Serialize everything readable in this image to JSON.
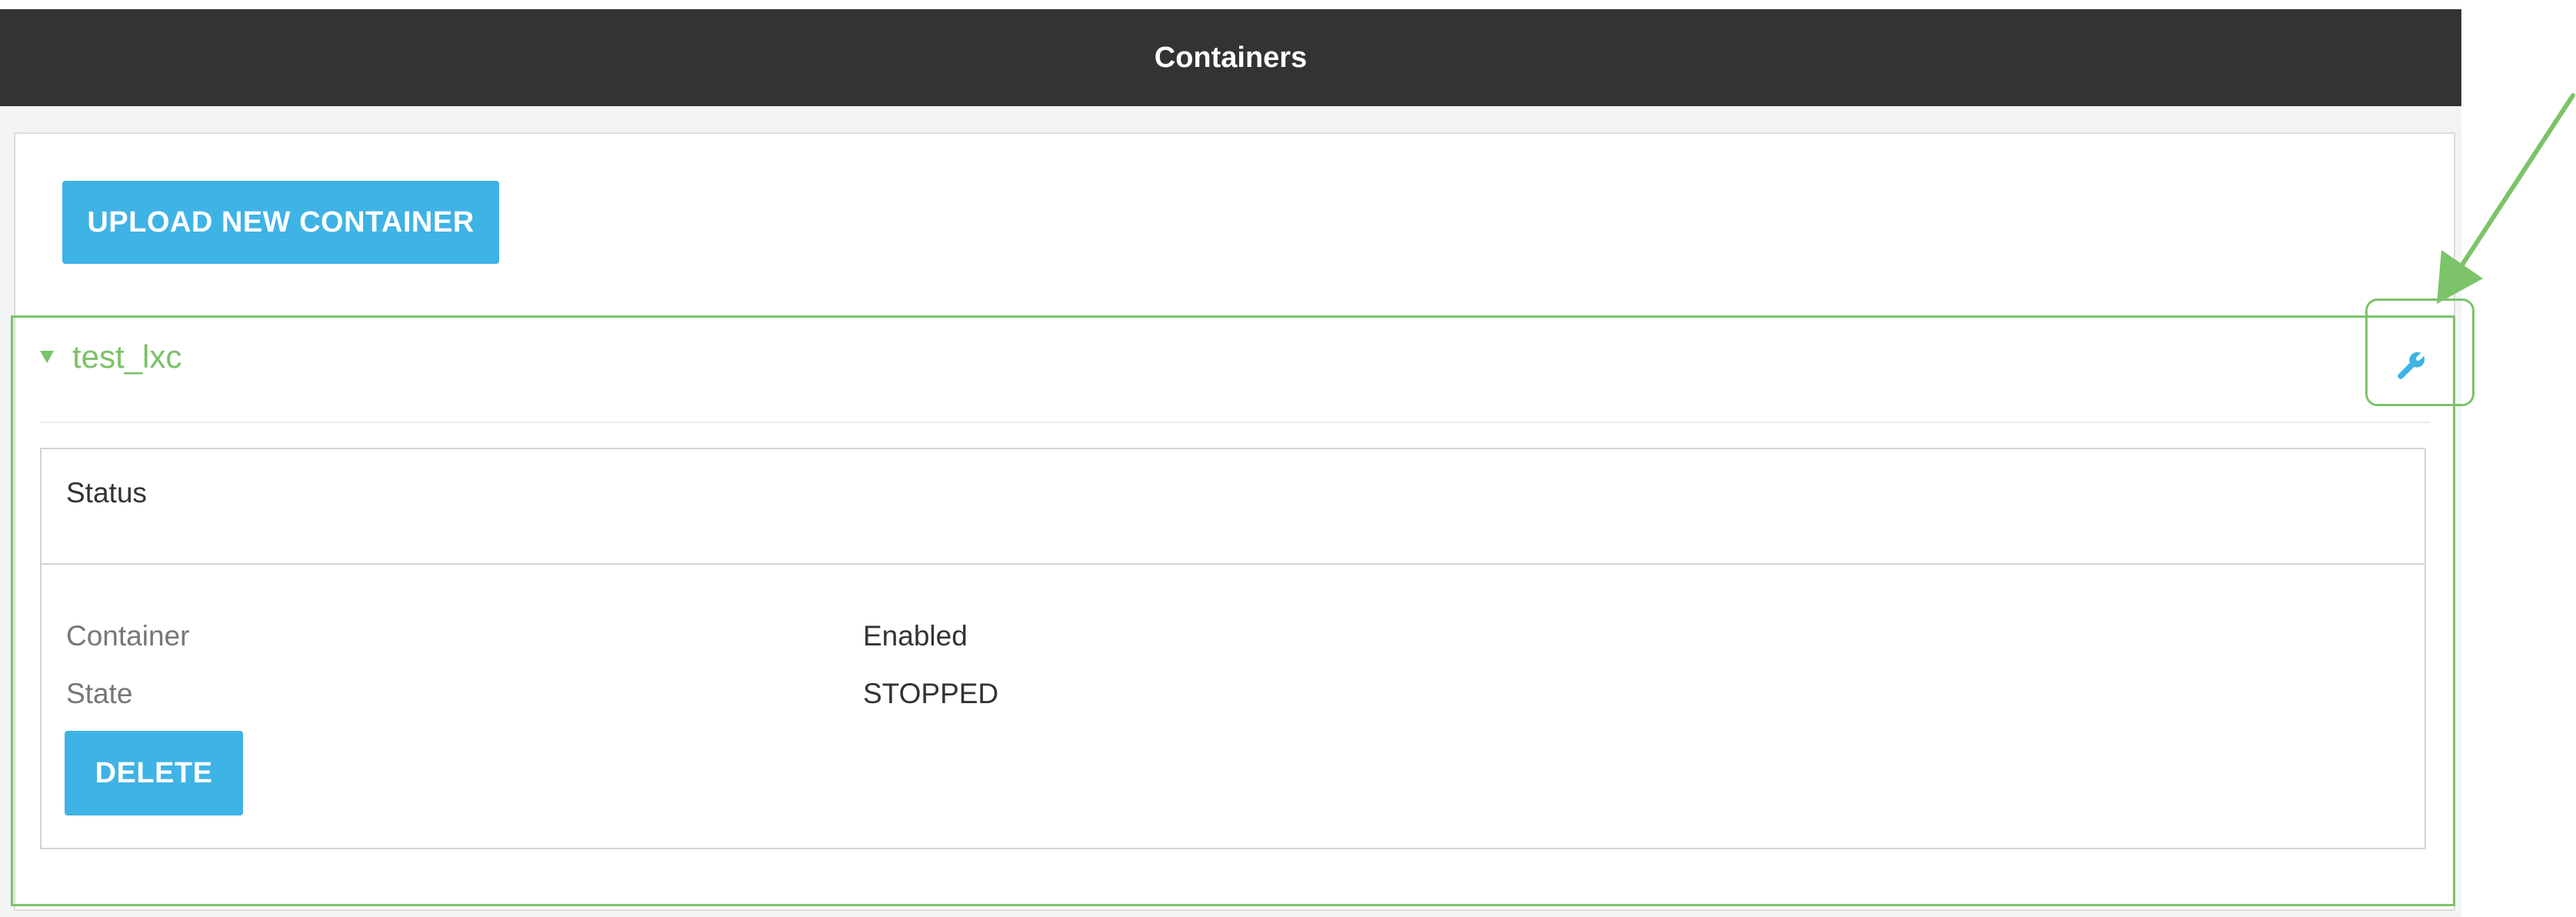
{
  "header": {
    "title": "Containers"
  },
  "actions": {
    "upload_label": "UPLOAD NEW CONTAINER"
  },
  "container": {
    "name": "test_lxc",
    "expanded_icon": "caret-down-icon",
    "config_icon": "wrench-icon",
    "status_section": {
      "title": "Status",
      "rows": [
        {
          "label": "Container",
          "value": "Enabled"
        },
        {
          "label": "State",
          "value": "STOPPED"
        }
      ]
    },
    "delete_label": "DELETE"
  },
  "colors": {
    "header_bg": "#333333",
    "button_bg": "#3eb3e5",
    "highlight_green": "#7cc36a",
    "container_name": "#79c267"
  },
  "annotation": {
    "arrow_icon": "annotation-arrow-icon",
    "highlight_target": "wrench-icon"
  }
}
